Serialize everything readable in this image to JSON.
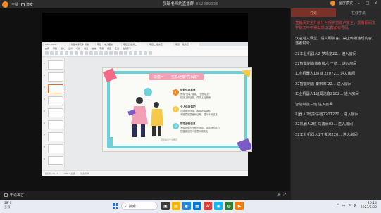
{
  "window": {
    "user_label": "主播",
    "mic_label": "連麦",
    "room_title": "张瑞老师的直播群",
    "room_id": "852389936",
    "mode_label": "全屏模式"
  },
  "ppt": {
    "tabs": [
      "WPS Office",
      "基础电子元件 识读",
      "项目一 电力拖动",
      "项目三 任务二",
      "项目二 任务三",
      "项目一 任务三"
    ],
    "menu": [
      "文件",
      "开始",
      "插入",
      "设计",
      "切换",
      "动画",
      "放映",
      "审阅",
      "视图",
      "工具",
      "会员专享"
    ],
    "slide": {
      "title": "隐患一——信息泄露\"亮出来\"",
      "points": [
        {
          "num": "1",
          "head": "获取信息渠道",
          "desc": "警惕\"伪装\"链接，\"虚假链接\"",
          "desc2": "链接上的信息，谨防上当受骗"
        },
        {
          "num": "2",
          "head": "个人信息保护",
          "desc": "谨慎填写信息，避免泄露隐私",
          "desc2": "不随意透露身份证号、银行卡号信息"
        },
        {
          "num": "3",
          "head": "防范虚假信息",
          "desc": "不轻信来历不明的信息，增强辨别能力",
          "desc2": "提醒身边的人注意网络安全"
        }
      ],
      "footer": "网络信息安全教育"
    },
    "status": [
      "幻灯片 3 / 15",
      "Office 主题",
      "缺失字体"
    ]
  },
  "stage": {
    "speak_label": "申请发言",
    "right_label": "直播中"
  },
  "panel": {
    "tabs": [
      "讨论",
      "在线学员"
    ],
    "notice": "直播间安全升级！为保护您账户安全，观看期间文字聊天中不得出现QQ群/QQ号码。",
    "welcome": "欢迎进入课堂，请文明发言，禁止传播违规内容，违者封号。",
    "messages": [
      "22工业机器人2 梦晴龙22... 进入房间",
      "22智能制造装备技术 王崎... 进入房间",
      "工业机器人1班肖 22072... 进入房间",
      "22智能制造 秦宋宋 22... 进入房间",
      "工业机器人1班周浩鑫2102... 进入房间",
      "智能制造三班 进入房间",
      "机器人2班彭子晗2207270... 进入房间",
      "22机器人2班 马鑫豪02... 进入房间",
      "22工业机器人1王俊鸿220... 进入房间"
    ]
  },
  "taskbar": {
    "weather_temp": "28°C",
    "weather_desc": "多云",
    "search_placeholder": "搜索",
    "time": "20:14",
    "date": "2023/5/30",
    "lang": "中"
  },
  "colors": {
    "chat_tab_active": "#7a3228",
    "notice_red": "#e5444e",
    "slide_border": "#6fd0d8",
    "slide_title": "#f39fb6"
  }
}
